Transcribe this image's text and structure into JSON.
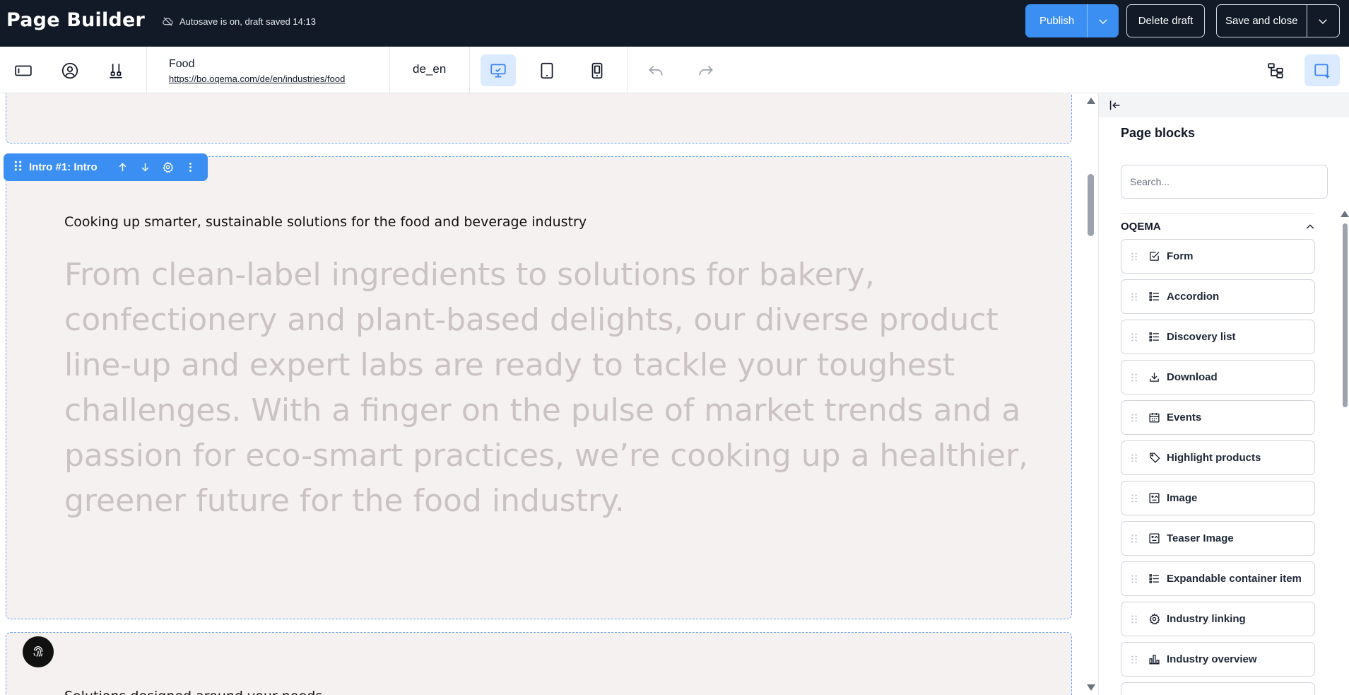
{
  "app": {
    "title": "Page Builder",
    "autosave_text": "Autosave is on, draft saved 14:13"
  },
  "actions": {
    "publish_label": "Publish",
    "delete_draft_label": "Delete draft",
    "save_close_label": "Save and close"
  },
  "page": {
    "name": "Food",
    "url": "https://bo.oqema.com/de/en/industries/food",
    "locale": "de_en"
  },
  "devices": {
    "active": "desktop"
  },
  "canvas": {
    "block_label": "Intro #1: Intro",
    "intro_heading": "Cooking up smarter, sustainable solutions for the food and beverage industry",
    "intro_body": "From clean-label ingredients to solutions for bakery, confectionery and plant-based delights, our diverse product line-up and expert labs are ready to tackle your toughest challenges. With a finger on the pulse of market trends and a passion for eco-smart practices, we’re cooking up a healthier, greener future for the food industry.",
    "next_heading": "Solutions designed around your needs"
  },
  "panel": {
    "title": "Page blocks",
    "search_placeholder": "Search...",
    "group_title": "OQEMA",
    "items": [
      {
        "label": "Form",
        "icon": "checkbox-icon"
      },
      {
        "label": "Accordion",
        "icon": "list-icon"
      },
      {
        "label": "Discovery list",
        "icon": "list-icon"
      },
      {
        "label": "Download",
        "icon": "download-icon"
      },
      {
        "label": "Events",
        "icon": "calendar-icon"
      },
      {
        "label": "Highlight products",
        "icon": "tag-icon"
      },
      {
        "label": "Image",
        "icon": "image-icon"
      },
      {
        "label": "Teaser Image",
        "icon": "image-icon"
      },
      {
        "label": "Expandable container item",
        "icon": "list-icon"
      },
      {
        "label": "Industry linking",
        "icon": "gear-icon"
      },
      {
        "label": "Industry overview",
        "icon": "bar-chart-icon"
      }
    ]
  },
  "colors": {
    "topbar_bg": "#121a27",
    "accent": "#3b8ff3",
    "canvas_block_bg": "#f5f1f0",
    "intro_body_text": "#cbc3c1"
  }
}
